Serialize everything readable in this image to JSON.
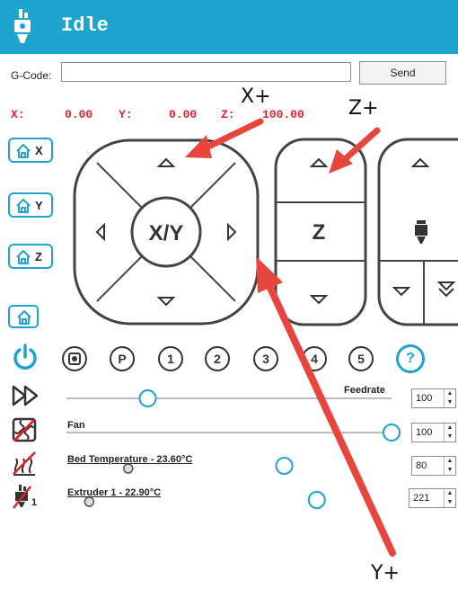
{
  "header": {
    "status": "Idle",
    "bg_color": "#1fa3cf",
    "logo_icon": "printer-head-icon"
  },
  "gcode": {
    "label": "G-Code:",
    "value": "",
    "placeholder": "",
    "send_label": "Send"
  },
  "coords": {
    "x_label": "X:",
    "x_value": "0.00",
    "y_label": "Y:",
    "y_value": "0.00",
    "z_label": "Z:",
    "z_value": "100.00",
    "color": "#e0202a"
  },
  "home": {
    "x_label": "X",
    "y_label": "Y",
    "z_label": "Z",
    "icon": "home-icon"
  },
  "jog": {
    "xy_label": "X/Y",
    "z_label": "Z"
  },
  "toolbar": {
    "power_icon": "power-icon",
    "stop_icon": "stop-icon",
    "park_label": "P",
    "presets": [
      "1",
      "2",
      "3",
      "4",
      "5"
    ],
    "help_label": "?"
  },
  "sliders": {
    "feedrate": {
      "label": "Feedrate",
      "value": "100",
      "icon": "fast-forward-icon",
      "level": 0.25
    },
    "fan": {
      "label": "Fan",
      "value": "100",
      "icon": "fan-off-icon",
      "level": 1.0
    },
    "bed": {
      "label": "Bed Temperature - 23.60°C",
      "value": "80",
      "icon": "bed-heat-icon",
      "current_level": 0.19,
      "target_level": 0.67
    },
    "extruder": {
      "label": "Extruder 1 - 22.90°C",
      "value": "221",
      "icon": "extruder-heat-icon",
      "icon_sub": "1",
      "current_level": 0.07,
      "target_level": 0.77
    }
  },
  "annotations": {
    "x_plus": "X+",
    "z_plus": "Z+",
    "y_plus": "Y+",
    "arrow_color": "#e8463c"
  }
}
